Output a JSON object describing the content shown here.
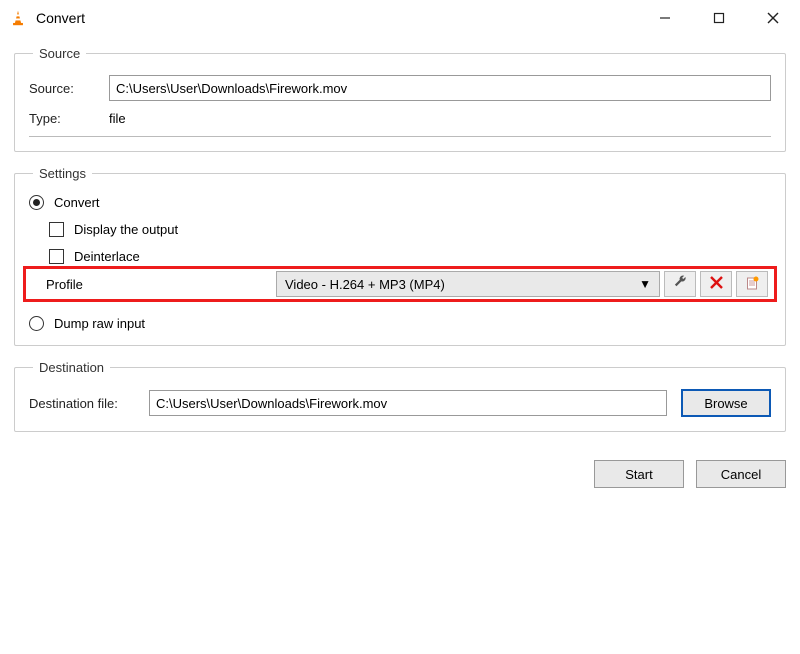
{
  "window": {
    "title": "Convert",
    "controls": {
      "minimize": "–",
      "maximize": "☐",
      "close": "✕"
    }
  },
  "source": {
    "legend": "Source",
    "label": "Source:",
    "value": "C:\\Users\\User\\Downloads\\Firework.mov",
    "type_label": "Type:",
    "type_value": "file"
  },
  "settings": {
    "legend": "Settings",
    "convert_label": "Convert",
    "display_output_label": "Display the output",
    "deinterlace_label": "Deinterlace",
    "profile_label": "Profile",
    "profile_value": "Video - H.264 + MP3 (MP4)",
    "dump_label": "Dump raw input"
  },
  "destination": {
    "legend": "Destination",
    "label": "Destination file:",
    "value": "C:\\Users\\User\\Downloads\\Firework.mov",
    "browse_label": "Browse"
  },
  "footer": {
    "start_label": "Start",
    "cancel_label": "Cancel"
  }
}
